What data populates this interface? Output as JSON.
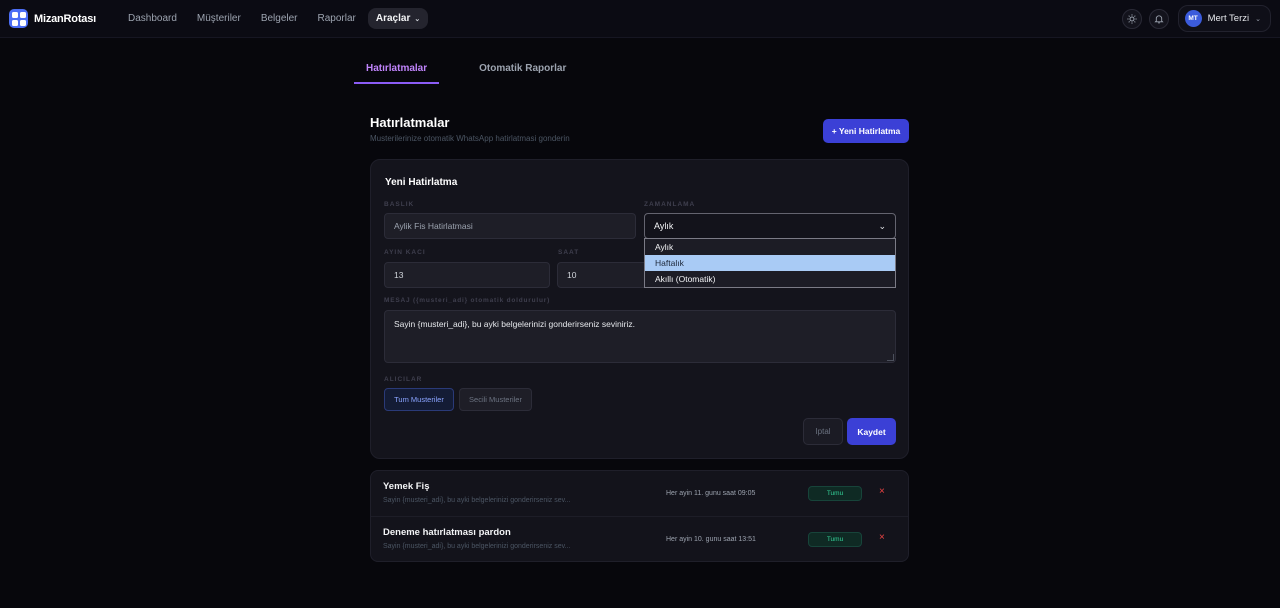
{
  "app": {
    "name": "MizanRotası"
  },
  "nav": {
    "links": [
      "Dashboard",
      "Müşteriler",
      "Belgeler",
      "Raporlar"
    ],
    "active": "Araçlar"
  },
  "user": {
    "initials": "MT",
    "name": "Mert Terzi"
  },
  "tabs": [
    "Hatırlatmalar",
    "Otomatik Raporlar"
  ],
  "header": {
    "title": "Hatırlatmalar",
    "subtitle": "Musterilerinize otomatik WhatsApp hatirlatmasi gonderin",
    "new_button": "+ Yeni Hatirlatma"
  },
  "form": {
    "title": "Yeni Hatirlatma",
    "baslik_label": "BASLIK",
    "baslik_value": "Aylik Fis Hatirlatmasi",
    "zamanlama_label": "ZAMANLAMA",
    "zamanlama_value": "Aylık",
    "zamanlama_options": [
      "Aylık",
      "Haftalık",
      "Akıllı (Otomatik)"
    ],
    "ayin_kaci_label": "AYIN KACI",
    "ayin_kaci_value": "13",
    "saat_label": "SAAT",
    "saat_value": "10",
    "mesaj_label": "MESAJ ({musteri_adi} otomatik doldurulur)",
    "mesaj_value": "Sayin {musteri_adi}, bu ayki belgelerinizi gonderirseniz seviniriz.",
    "alicilar_label": "ALICILAR",
    "chip_all": "Tum Musteriler",
    "chip_selected": "Secili Musteriler",
    "cancel": "Iptal",
    "save": "Kaydet"
  },
  "reminders": [
    {
      "title": "Yemek Fiş",
      "message": "Sayin {musteri_adi}, bu ayki belgelerinizi gonderirseniz sev...",
      "schedule": "Her ayin 11. gunu saat 09:05",
      "status": "Tumu",
      "delete": "×"
    },
    {
      "title": "Deneme hatırlatması pardon",
      "message": "Sayin {musteri_adi}, bu ayki belgelerinizi gonderirseniz sev...",
      "schedule": "Her ayin 10. gunu saat 13:51",
      "status": "Tumu",
      "delete": "×"
    }
  ],
  "colors": {
    "accent": "#3b40d6",
    "tab_active": "#c084fc",
    "badge_green": "#34d399",
    "danger": "#ef4444"
  }
}
